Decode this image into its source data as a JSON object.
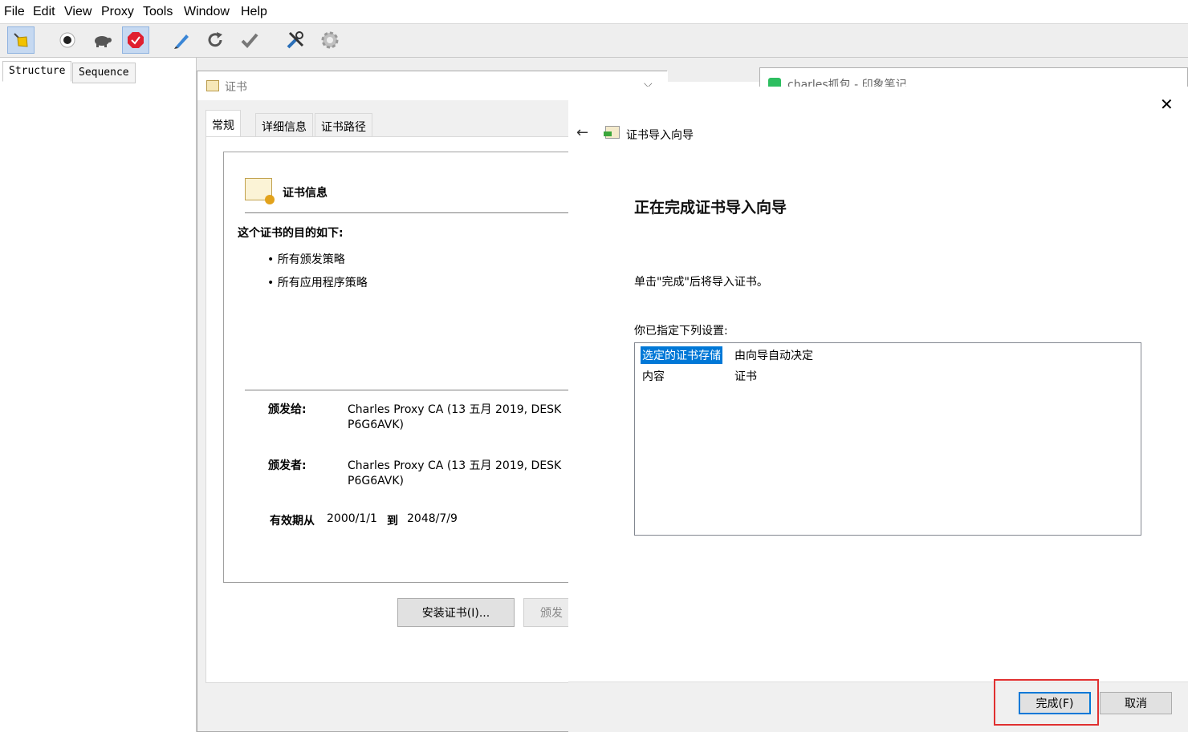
{
  "menubar": {
    "items": [
      "File",
      "Edit",
      "View",
      "Proxy",
      "Tools",
      "Window",
      "Help"
    ]
  },
  "toolbar": {
    "icons": [
      "broom-icon",
      "record-icon",
      "throttle-turtle-icon",
      "breakpoints-icon",
      "compose-pen-icon",
      "repeat-icon",
      "validate-check-icon",
      "tools-icon",
      "settings-gear-icon"
    ]
  },
  "charles": {
    "tabs": [
      "Structure",
      "Sequence"
    ]
  },
  "cert_dialog": {
    "title": "证书",
    "tabs": [
      "常规",
      "详细信息",
      "证书路径"
    ],
    "info_heading": "证书信息",
    "purpose_heading": "这个证书的目的如下:",
    "purposes": [
      "所有颁发策略",
      "所有应用程序策略"
    ],
    "issued_to_label": "颁发给:",
    "issued_to_line1": "Charles Proxy CA (13 五月 2019, DESK",
    "issued_to_line2": "P6G6AVK)",
    "issued_by_label": "颁发者:",
    "issued_by_line1": "Charles Proxy CA (13 五月 2019, DESK",
    "issued_by_line2": "P6G6AVK)",
    "valid_from_label": "有效期从",
    "valid_from": "2000/1/1",
    "valid_to_label": "到",
    "valid_to": "2048/7/9",
    "install_button": "安装证书(I)...",
    "issuer_statement_button": "颁发"
  },
  "evernote": {
    "title": "charles抓包 - 印象笔记"
  },
  "wizard": {
    "header_title": "证书导入向导",
    "heading": "正在完成证书导入向导",
    "instruction": "单击\"完成\"后将导入证书。",
    "settings_label": "你已指定下列设置:",
    "settings": [
      {
        "key": "选定的证书存储",
        "value": "由向导自动决定"
      },
      {
        "key": "内容",
        "value": "证书"
      }
    ],
    "finish_button": "完成(F)",
    "cancel_button": "取消",
    "highlight_color": "#e03030"
  }
}
